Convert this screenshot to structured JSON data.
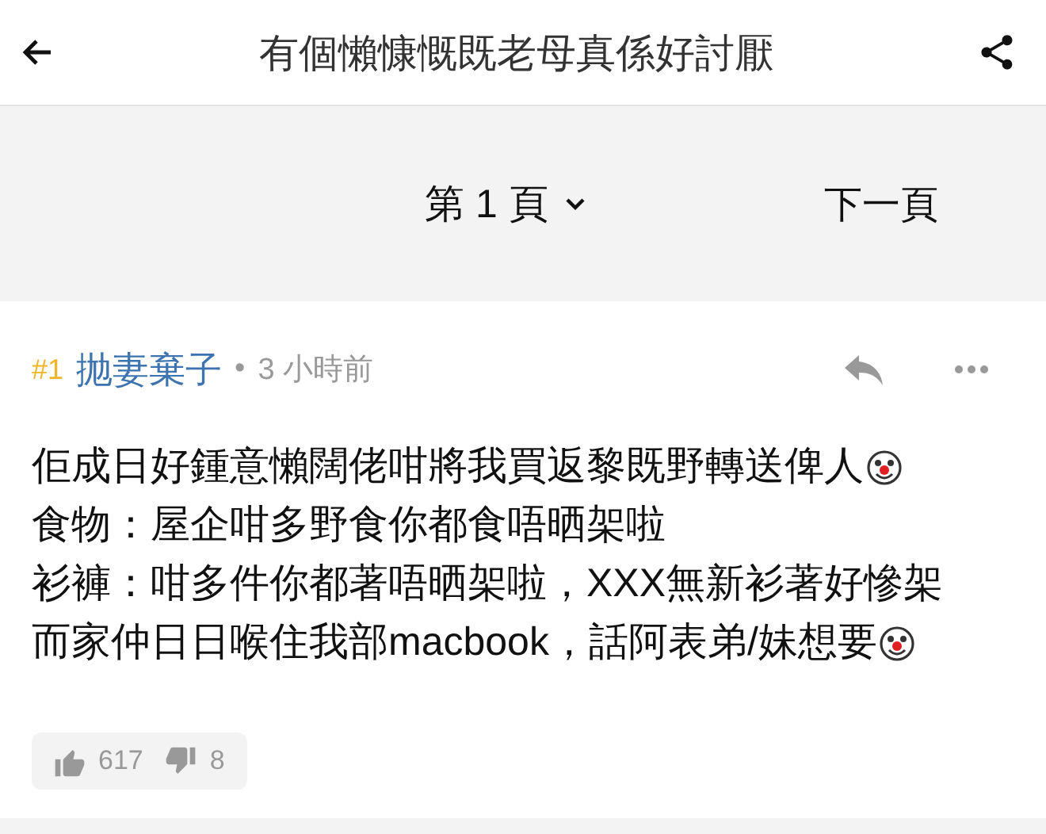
{
  "header": {
    "title": "有個懶慷慨既老母真係好討厭"
  },
  "pager": {
    "page_label": "第 1 頁",
    "next_label": "下一頁"
  },
  "post": {
    "number": "#1",
    "author": "抛妻棄子",
    "separator": "•",
    "time": "3 小時前",
    "lines": [
      {
        "text": "佢成日好鍾意懶闊佬咁將我買返黎既野轉送俾人",
        "emoji": true
      },
      {
        "text": "食物：屋企咁多野食你都食唔晒架啦",
        "emoji": false
      },
      {
        "text": "衫褲：咁多件你都著唔晒架啦，XXX無新衫著好慘架",
        "emoji": false
      },
      {
        "text": "而家仲日日喉住我部macbook，話阿表弟/妹想要",
        "emoji": true
      }
    ],
    "likes": "617",
    "dislikes": "8"
  }
}
